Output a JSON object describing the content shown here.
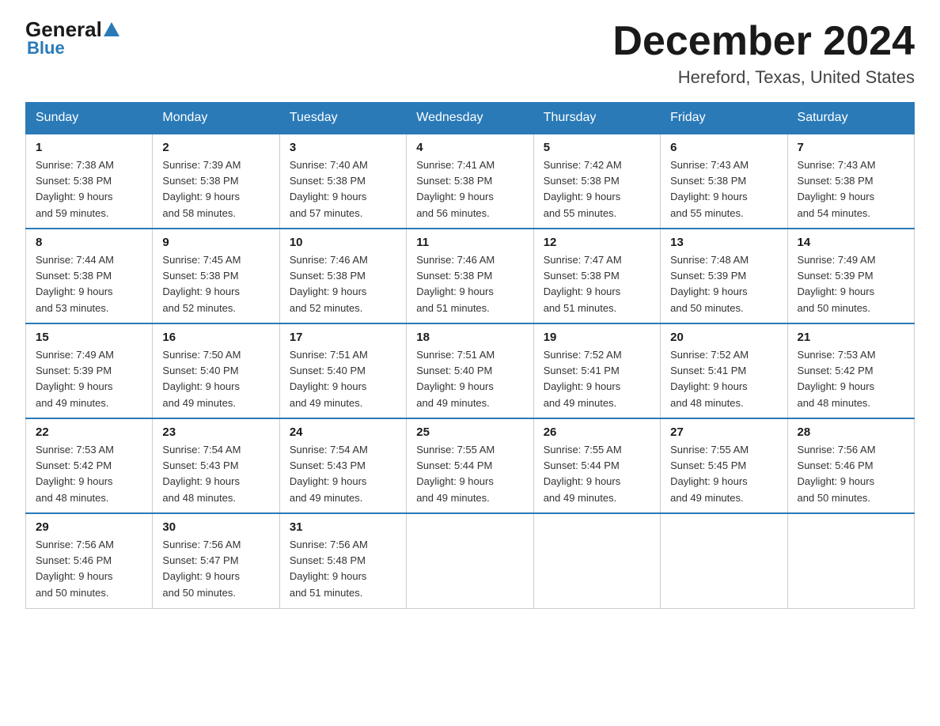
{
  "header": {
    "logo_general": "General",
    "logo_blue": "Blue",
    "month_title": "December 2024",
    "location": "Hereford, Texas, United States"
  },
  "weekdays": [
    "Sunday",
    "Monday",
    "Tuesday",
    "Wednesday",
    "Thursday",
    "Friday",
    "Saturday"
  ],
  "weeks": [
    [
      {
        "day": "1",
        "sunrise": "7:38 AM",
        "sunset": "5:38 PM",
        "daylight": "9 hours and 59 minutes."
      },
      {
        "day": "2",
        "sunrise": "7:39 AM",
        "sunset": "5:38 PM",
        "daylight": "9 hours and 58 minutes."
      },
      {
        "day": "3",
        "sunrise": "7:40 AM",
        "sunset": "5:38 PM",
        "daylight": "9 hours and 57 minutes."
      },
      {
        "day": "4",
        "sunrise": "7:41 AM",
        "sunset": "5:38 PM",
        "daylight": "9 hours and 56 minutes."
      },
      {
        "day": "5",
        "sunrise": "7:42 AM",
        "sunset": "5:38 PM",
        "daylight": "9 hours and 55 minutes."
      },
      {
        "day": "6",
        "sunrise": "7:43 AM",
        "sunset": "5:38 PM",
        "daylight": "9 hours and 55 minutes."
      },
      {
        "day": "7",
        "sunrise": "7:43 AM",
        "sunset": "5:38 PM",
        "daylight": "9 hours and 54 minutes."
      }
    ],
    [
      {
        "day": "8",
        "sunrise": "7:44 AM",
        "sunset": "5:38 PM",
        "daylight": "9 hours and 53 minutes."
      },
      {
        "day": "9",
        "sunrise": "7:45 AM",
        "sunset": "5:38 PM",
        "daylight": "9 hours and 52 minutes."
      },
      {
        "day": "10",
        "sunrise": "7:46 AM",
        "sunset": "5:38 PM",
        "daylight": "9 hours and 52 minutes."
      },
      {
        "day": "11",
        "sunrise": "7:46 AM",
        "sunset": "5:38 PM",
        "daylight": "9 hours and 51 minutes."
      },
      {
        "day": "12",
        "sunrise": "7:47 AM",
        "sunset": "5:38 PM",
        "daylight": "9 hours and 51 minutes."
      },
      {
        "day": "13",
        "sunrise": "7:48 AM",
        "sunset": "5:39 PM",
        "daylight": "9 hours and 50 minutes."
      },
      {
        "day": "14",
        "sunrise": "7:49 AM",
        "sunset": "5:39 PM",
        "daylight": "9 hours and 50 minutes."
      }
    ],
    [
      {
        "day": "15",
        "sunrise": "7:49 AM",
        "sunset": "5:39 PM",
        "daylight": "9 hours and 49 minutes."
      },
      {
        "day": "16",
        "sunrise": "7:50 AM",
        "sunset": "5:40 PM",
        "daylight": "9 hours and 49 minutes."
      },
      {
        "day": "17",
        "sunrise": "7:51 AM",
        "sunset": "5:40 PM",
        "daylight": "9 hours and 49 minutes."
      },
      {
        "day": "18",
        "sunrise": "7:51 AM",
        "sunset": "5:40 PM",
        "daylight": "9 hours and 49 minutes."
      },
      {
        "day": "19",
        "sunrise": "7:52 AM",
        "sunset": "5:41 PM",
        "daylight": "9 hours and 49 minutes."
      },
      {
        "day": "20",
        "sunrise": "7:52 AM",
        "sunset": "5:41 PM",
        "daylight": "9 hours and 48 minutes."
      },
      {
        "day": "21",
        "sunrise": "7:53 AM",
        "sunset": "5:42 PM",
        "daylight": "9 hours and 48 minutes."
      }
    ],
    [
      {
        "day": "22",
        "sunrise": "7:53 AM",
        "sunset": "5:42 PM",
        "daylight": "9 hours and 48 minutes."
      },
      {
        "day": "23",
        "sunrise": "7:54 AM",
        "sunset": "5:43 PM",
        "daylight": "9 hours and 48 minutes."
      },
      {
        "day": "24",
        "sunrise": "7:54 AM",
        "sunset": "5:43 PM",
        "daylight": "9 hours and 49 minutes."
      },
      {
        "day": "25",
        "sunrise": "7:55 AM",
        "sunset": "5:44 PM",
        "daylight": "9 hours and 49 minutes."
      },
      {
        "day": "26",
        "sunrise": "7:55 AM",
        "sunset": "5:44 PM",
        "daylight": "9 hours and 49 minutes."
      },
      {
        "day": "27",
        "sunrise": "7:55 AM",
        "sunset": "5:45 PM",
        "daylight": "9 hours and 49 minutes."
      },
      {
        "day": "28",
        "sunrise": "7:56 AM",
        "sunset": "5:46 PM",
        "daylight": "9 hours and 50 minutes."
      }
    ],
    [
      {
        "day": "29",
        "sunrise": "7:56 AM",
        "sunset": "5:46 PM",
        "daylight": "9 hours and 50 minutes."
      },
      {
        "day": "30",
        "sunrise": "7:56 AM",
        "sunset": "5:47 PM",
        "daylight": "9 hours and 50 minutes."
      },
      {
        "day": "31",
        "sunrise": "7:56 AM",
        "sunset": "5:48 PM",
        "daylight": "9 hours and 51 minutes."
      },
      null,
      null,
      null,
      null
    ]
  ],
  "labels": {
    "sunrise": "Sunrise:",
    "sunset": "Sunset:",
    "daylight": "Daylight:"
  }
}
